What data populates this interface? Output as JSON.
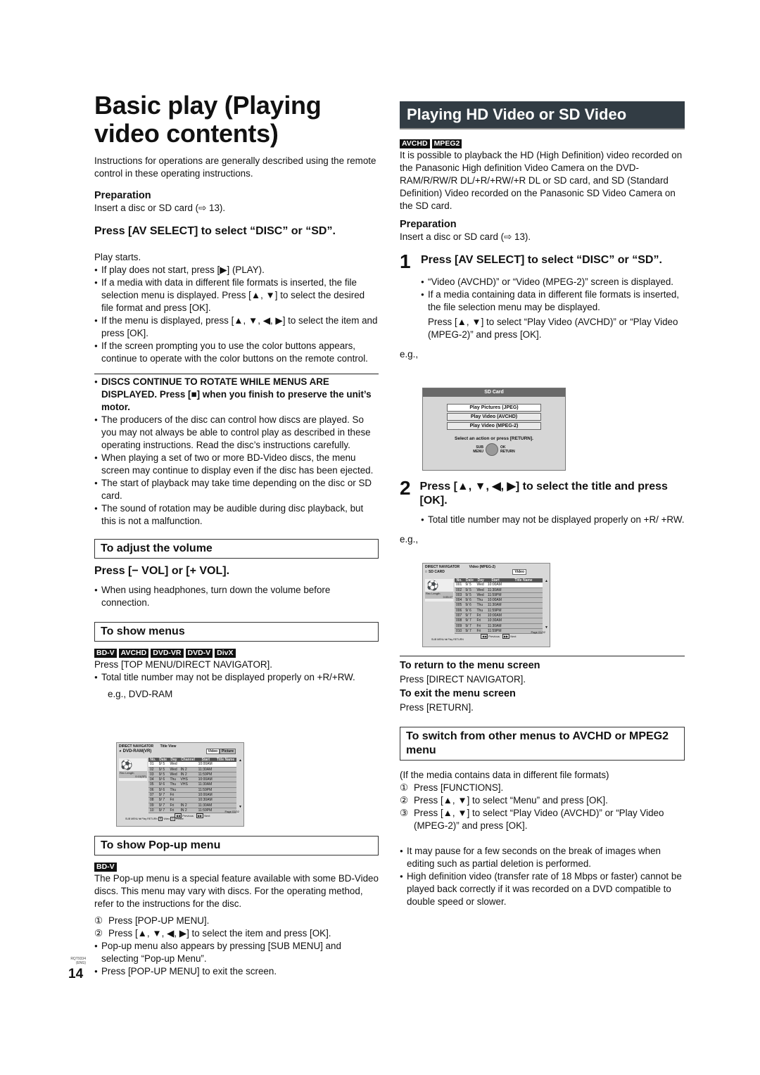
{
  "left": {
    "title": "Basic play (Playing video contents)",
    "intro": "Instructions for operations are generally described using the remote control in these operating instructions.",
    "preparation_heading": "Preparation",
    "preparation_text": "Insert a disc or SD card (⇨ 13).",
    "step_heading": "Press [AV SELECT] to select “DISC” or “SD”.",
    "play_starts": "Play starts.",
    "play_bullets": [
      "If play does not start, press [▶] (PLAY).",
      "If a media with data in different file formats is inserted, the file selection menu is displayed. Press [▲, ▼] to select the desired file format and press [OK].",
      "If the menu is displayed, press [▲, ▼, ◀, ▶] to select the item and press [OK].",
      "If the screen prompting you to use the color buttons appears, continue to operate with the color buttons on the remote control."
    ],
    "warning": "DISCS CONTINUE TO ROTATE WHILE MENUS ARE DISPLAYED. Press [■] when you finish to preserve the unit’s motor.",
    "notes": [
      "The producers of the disc can control how discs are played. So you may not always be able to control play as described in these operating instructions. Read the disc’s instructions carefully.",
      "When playing a set of two or more BD-Video discs, the menu screen may continue to display even if the disc has been ejected.",
      "The start of playback may take time depending on the disc or SD card.",
      "The sound of rotation may be audible during disc playback, but this is not a malfunction."
    ],
    "volume": {
      "heading": "To adjust the volume",
      "step": "Press [− VOL] or [+ VOL].",
      "bullet": "When using headphones, turn down the volume before connection."
    },
    "menus": {
      "heading": "To show menus",
      "tags": [
        "BD-V",
        "AVCHD",
        "DVD-VR",
        "DVD-V",
        "DivX"
      ],
      "text": "Press [TOP MENU/DIRECT NAVIGATOR].",
      "bullet": "Total title number may not be displayed properly on +R/+RW.",
      "example": "e.g., DVD-RAM"
    },
    "popup": {
      "heading": "To show Pop-up menu",
      "tag": "BD-V",
      "text": "The Pop-up menu is a special feature available with some BD-Video discs. This menu may vary with discs. For the operating method, refer to the instructions for the disc.",
      "steps": [
        {
          "num": "①",
          "text": "Press [POP-UP MENU]."
        },
        {
          "num": "②",
          "text": "Press [▲, ▼, ◀, ▶] to select the item and press [OK]."
        }
      ],
      "bullets": [
        "Pop-up menu also appears by pressing [SUB MENU] and selecting “Pop-up Menu”.",
        "Press [POP-UP MENU] to exit the screen."
      ]
    }
  },
  "dvd_screen": {
    "title": "DIRECT NAVIGATOR",
    "view": "Title View",
    "media": "DVD-RAM(VR)",
    "tabs": [
      "Video",
      "Picture"
    ],
    "rec_length_label": "Rec Length",
    "rec_length_value": "0:10(SP)",
    "columns": [
      "No.",
      "Date",
      "Day",
      "Channel",
      "Start",
      "Title Name"
    ],
    "rows": [
      [
        "01",
        "9/ 5",
        "Wed",
        "",
        "10:00AM",
        ""
      ],
      [
        "02",
        "9/ 5",
        "Wed",
        "IN 2",
        "11:30AM",
        ""
      ],
      [
        "03",
        "9/ 5",
        "Wed",
        "IN 2",
        "11:59PM",
        ""
      ],
      [
        "04",
        "9/ 6",
        "Thu",
        "VHS",
        "10:00AM",
        ""
      ],
      [
        "05",
        "9/ 6",
        "Thu",
        "VHS",
        "11:30AM",
        ""
      ],
      [
        "06",
        "9/ 6",
        "Thu",
        "",
        "11:59PM",
        ""
      ],
      [
        "07",
        "9/ 7",
        "Fri",
        "",
        "10:00AM",
        ""
      ],
      [
        "08",
        "9/ 7",
        "Fri",
        "",
        "10:30AM",
        ""
      ],
      [
        "09",
        "9/ 7",
        "Fri",
        "IN 2",
        "11:30AM",
        ""
      ],
      [
        "10",
        "9/ 7",
        "Fri",
        "IN 2",
        "11:59PM",
        ""
      ]
    ],
    "page": "Page 01/02",
    "prev": "Previous",
    "next": "Next",
    "sub_menu": "SUB MENU",
    "play": "Play",
    "return": "RETURN",
    "r_label": "Video",
    "g_label": "Picture"
  },
  "right": {
    "banner": "Playing HD Video or SD Video",
    "tags": [
      "AVCHD",
      "MPEG2"
    ],
    "intro": "It is possible to playback the HD (High Definition) video recorded on the Panasonic High definition Video Camera on the DVD-RAM/R/RW/R DL/+R/+RW/+R DL or SD card, and SD (Standard Definition) Video recorded on the Panasonic SD Video Camera on the SD card.",
    "preparation_heading": "Preparation",
    "preparation_text": "Insert a disc or SD card (⇨ 13).",
    "step1": {
      "num": "1",
      "heading": "Press [AV SELECT] to select “DISC” or “SD”.",
      "bullets": [
        "“Video (AVCHD)” or “Video (MPEG-2)” screen is displayed.",
        "If a media containing data in different file formats is inserted, the file selection menu may be displayed."
      ],
      "sub": "Press [▲, ▼] to select “Play Video (AVCHD)” or “Play Video (MPEG-2)” and press [OK].",
      "example": "e.g.,"
    },
    "step2": {
      "num": "2",
      "heading": "Press [▲, ▼, ◀, ▶] to select the title and press [OK].",
      "bullet": "Total title number may not be displayed properly on +R/ +RW.",
      "example": "e.g.,"
    },
    "return_heading": "To return to the menu screen",
    "return_text": "Press [DIRECT NAVIGATOR].",
    "exit_heading": "To exit the menu screen",
    "exit_text": "Press [RETURN].",
    "switch": {
      "heading": "To switch from other menus to AVCHD or MPEG2 menu",
      "condition": "(If the media contains data in different file formats)",
      "steps": [
        {
          "num": "①",
          "text": "Press [FUNCTIONS]."
        },
        {
          "num": "②",
          "text": "Press [▲, ▼] to select “Menu” and press [OK]."
        },
        {
          "num": "③",
          "text": "Press [▲, ▼] to select “Play Video (AVCHD)” or “Play Video (MPEG-2)” and press [OK]."
        }
      ]
    },
    "notes": [
      "It may pause for a few seconds on the break of images when editing such as partial deletion is performed.",
      "High definition video (transfer rate of 18 Mbps or faster) cannot be played back correctly if it was recorded on a DVD compatible to double speed or slower."
    ]
  },
  "sd_screen": {
    "title": "SD Card",
    "options": [
      "Play Pictures (JPEG)",
      "Play Video (AVCHD)",
      "Play Video (MPEG-2)"
    ],
    "prompt": "Select an action or press [RETURN].",
    "sub": "SUB",
    "menu": "MENU",
    "ok": "OK",
    "return": "RETURN"
  },
  "mpeg_screen": {
    "title": "DIRECT NAVIGATOR",
    "view": "Video (MPEG-2)",
    "media": "SD CARD",
    "tab": "Video",
    "rec_length_label": "Rec Length",
    "rec_length_value": "0:05:47",
    "columns": [
      "No.",
      "Date",
      "Day",
      "Start",
      "Title Name"
    ],
    "rows": [
      [
        "001",
        "9/ 5",
        "Wed",
        "10:00AM",
        ""
      ],
      [
        "002",
        "9/ 5",
        "Wed",
        "11:30AM",
        ""
      ],
      [
        "003",
        "9/ 5",
        "Wed",
        "11:59PM",
        ""
      ],
      [
        "004",
        "9/ 6",
        "Thu",
        "10:00AM",
        ""
      ],
      [
        "005",
        "9/ 6",
        "Thu",
        "11:30AM",
        ""
      ],
      [
        "006",
        "9/ 6",
        "Thu",
        "11:59PM",
        ""
      ],
      [
        "007",
        "9/ 7",
        "Fri",
        "10:00AM",
        ""
      ],
      [
        "008",
        "9/ 7",
        "Fri",
        "10:30AM",
        ""
      ],
      [
        "009",
        "9/ 7",
        "Fri",
        "11:30AM",
        ""
      ],
      [
        "010",
        "9/ 7",
        "Fri",
        "11:59PM",
        ""
      ]
    ],
    "page": "Page 01/02",
    "prev": "Previous",
    "next": "Next",
    "sub_menu": "SUB MENU",
    "play": "Play",
    "return": "RETURN"
  },
  "footer": {
    "code": "RQT9334",
    "lang": "(ENG)",
    "page": "14"
  }
}
